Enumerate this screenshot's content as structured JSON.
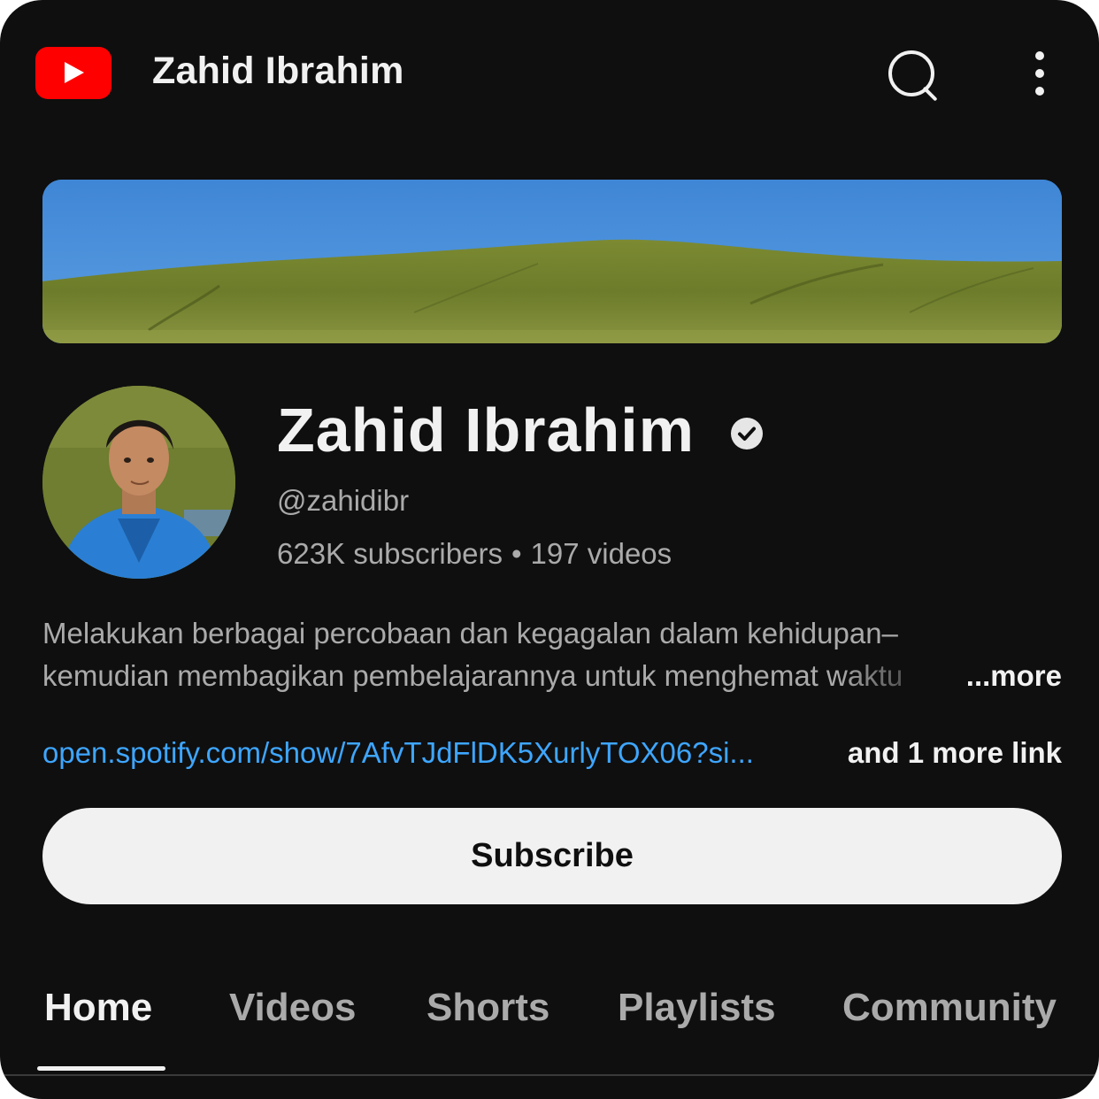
{
  "topbar": {
    "title": "Zahid Ibrahim",
    "logo_icon": "youtube-logo-icon",
    "search_icon": "search-icon",
    "menu_icon": "more-vertical-icon"
  },
  "channel": {
    "name": "Zahid Ibrahim",
    "verified_icon": "verified-check-icon",
    "handle": "@zahidibr",
    "subscribers": "623K subscribers",
    "separator": "•",
    "videos": "197 videos",
    "description_line1": "Melakukan berbagai percobaan dan kegagalan dalam kehidupan–",
    "description_line2": "kemudian membagikan pembelajarannya untuk menghemat waktu",
    "more_label": "...more",
    "link_url": "open.spotify.com/show/7AfvTJdFlDK5XurlyTOX06?si...",
    "link_more": "and 1 more link"
  },
  "subscribe": {
    "label": "Subscribe"
  },
  "tabs": [
    {
      "label": "Home",
      "active": true
    },
    {
      "label": "Videos",
      "active": false
    },
    {
      "label": "Shorts",
      "active": false
    },
    {
      "label": "Playlists",
      "active": false
    },
    {
      "label": "Community",
      "active": false
    }
  ],
  "colors": {
    "background": "#0f0f0f",
    "brand_red": "#ff0000",
    "link_blue": "#3ea6ff",
    "primary_text": "#f1f1f1",
    "secondary_text": "#aaaaaa"
  }
}
